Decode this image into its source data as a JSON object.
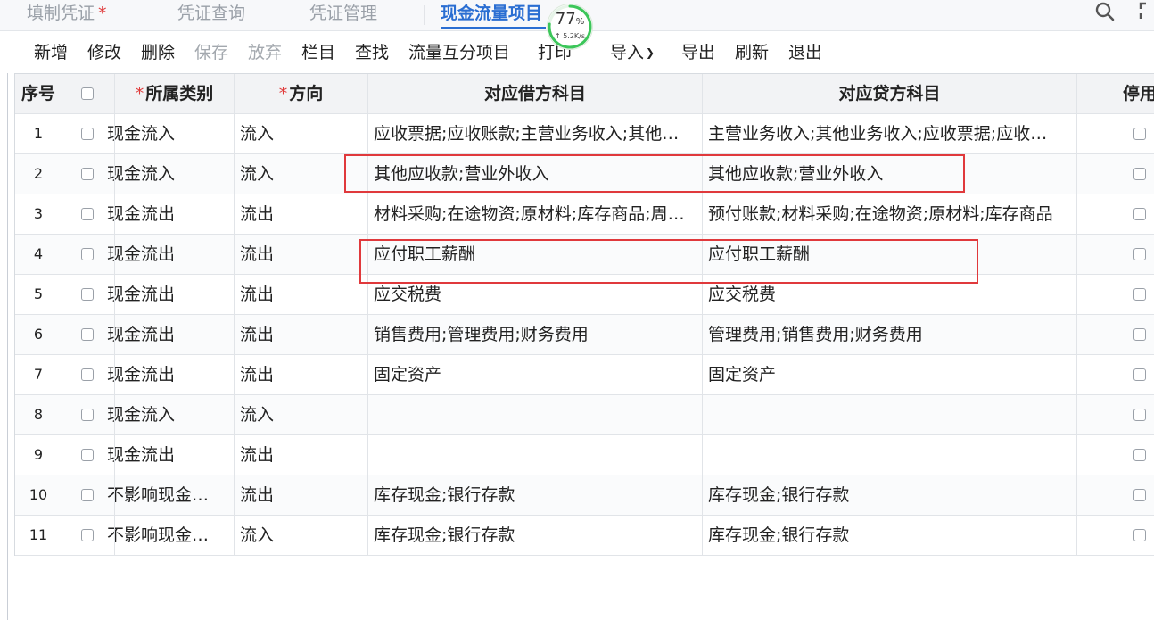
{
  "tabs": [
    {
      "label": "填制凭证",
      "required_mark": "*"
    },
    {
      "label": "凭证查询"
    },
    {
      "label": "凭证管理"
    },
    {
      "label": "现金流量项目",
      "active": true
    }
  ],
  "speed_widget": {
    "percent": "77",
    "unit": "%",
    "rate": "↑ 5.2K/s"
  },
  "toolbar": {
    "new": "新增",
    "edit": "修改",
    "delete": "删除",
    "save": "保存",
    "discard": "放弃",
    "columns": "栏目",
    "find": "查找",
    "cross_items": "流量互分项目",
    "print": "打印",
    "import": "导入",
    "export": "导出",
    "refresh": "刷新",
    "exit": "退出"
  },
  "table": {
    "headers": {
      "index": "序号",
      "category": "所属类别",
      "direction": "方向",
      "debit": "对应借方科目",
      "credit": "对应贷方科目",
      "disabled": "停用",
      "required_mark": "*"
    },
    "rows": [
      {
        "index": "1",
        "category": "现金流入",
        "direction": "流入",
        "debit": "应收票据;应收账款;主营业务收入;其他业务收入",
        "credit": "主营业务收入;其他业务收入;应收票据;应收账款"
      },
      {
        "index": "2",
        "category": "现金流入",
        "direction": "流入",
        "debit": "其他应收款;营业外收入",
        "credit": "其他应收款;营业外收入"
      },
      {
        "index": "3",
        "category": "现金流出",
        "direction": "流出",
        "debit": "材料采购;在途物资;原材料;库存商品;周转材料",
        "credit": "预付账款;材料采购;在途物资;原材料;库存商品"
      },
      {
        "index": "4",
        "category": "现金流出",
        "direction": "流出",
        "debit": "应付职工薪酬",
        "credit": "应付职工薪酬"
      },
      {
        "index": "5",
        "category": "现金流出",
        "direction": "流出",
        "debit": "应交税费",
        "credit": "应交税费"
      },
      {
        "index": "6",
        "category": "现金流出",
        "direction": "流出",
        "debit": "销售费用;管理费用;财务费用",
        "credit": "管理费用;销售费用;财务费用"
      },
      {
        "index": "7",
        "category": "现金流出",
        "direction": "流出",
        "debit": "固定资产",
        "credit": "固定资产"
      },
      {
        "index": "8",
        "category": "现金流入",
        "direction": "流入",
        "debit": "",
        "credit": ""
      },
      {
        "index": "9",
        "category": "现金流出",
        "direction": "流出",
        "debit": "",
        "credit": ""
      },
      {
        "index": "10",
        "category": "不影响现金流量",
        "direction": "流出",
        "debit": "库存现金;银行存款",
        "credit": "库存现金;银行存款"
      },
      {
        "index": "11",
        "category": "不影响现金流量",
        "direction": "流入",
        "debit": "库存现金;银行存款",
        "credit": "库存现金;银行存款"
      }
    ]
  },
  "colors": {
    "accent": "#2a6ed2",
    "required": "#e03b3b",
    "highlight_box": "#e0393c",
    "speed_ring": "#3cc65a"
  },
  "icons": [
    "search-icon",
    "expand-icon",
    "chevron-down-icon",
    "checkbox-icon"
  ]
}
